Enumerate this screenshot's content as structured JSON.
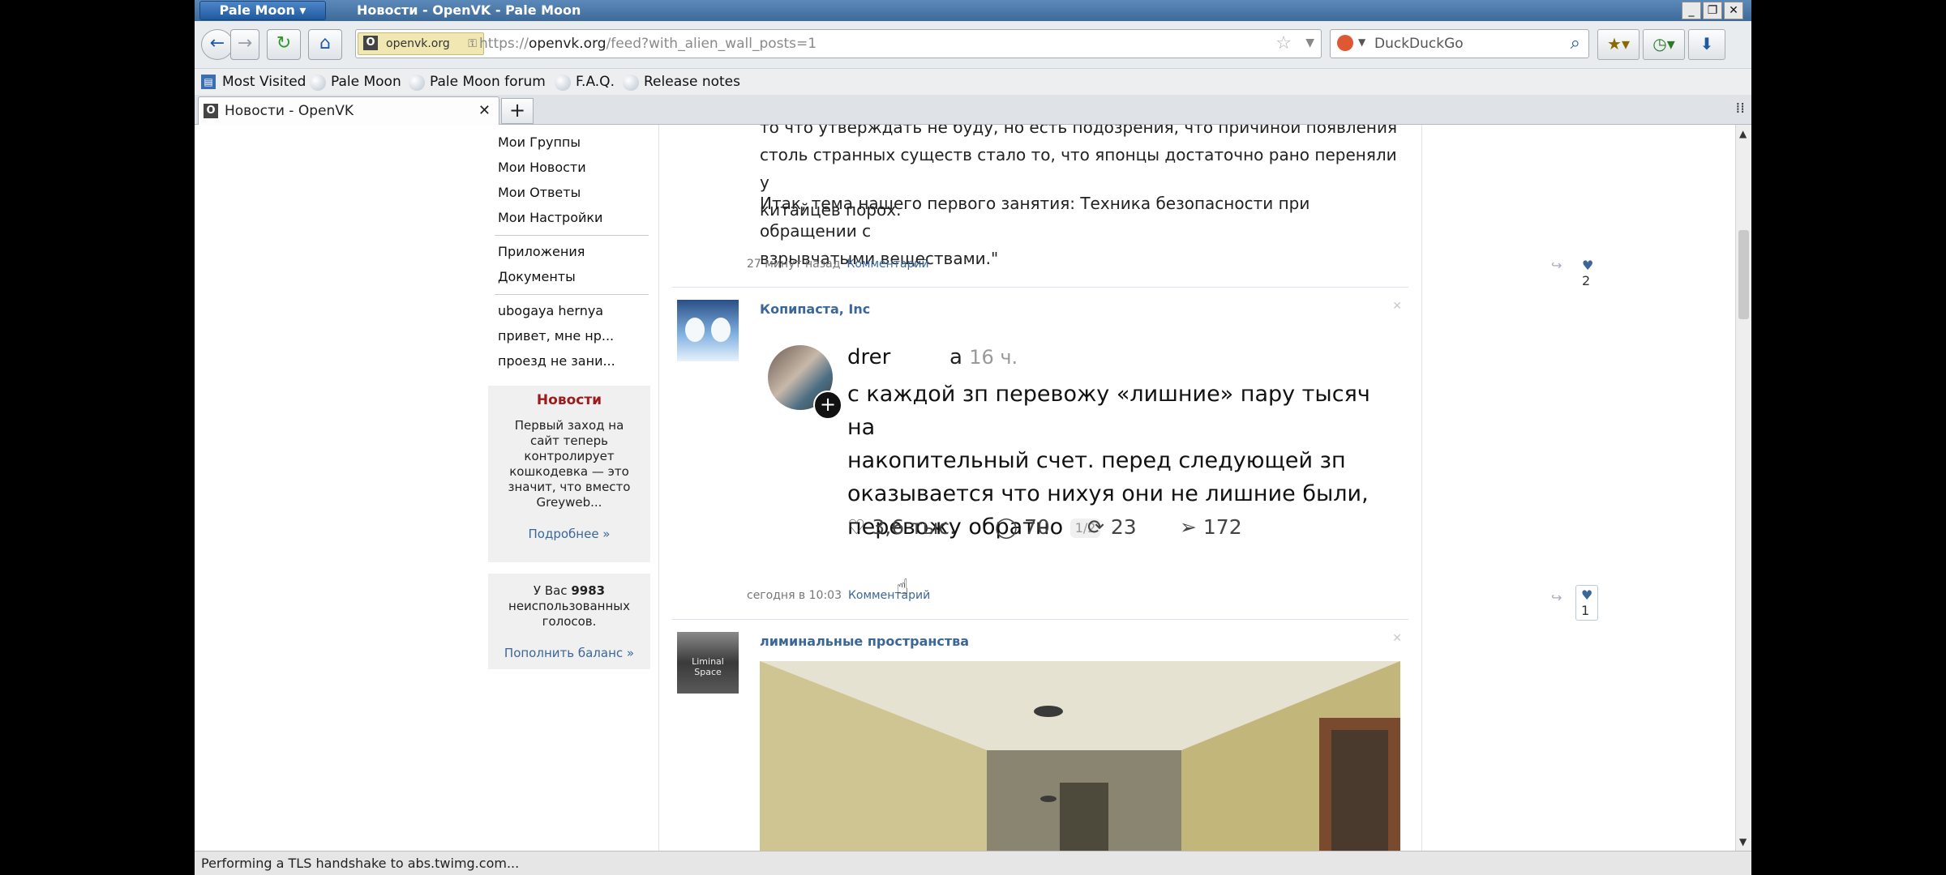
{
  "window": {
    "app_menu": "Pale Moon",
    "title": "Новости - OpenVK - Pale Moon",
    "min": "_",
    "restore": "❐",
    "close": "✕"
  },
  "nav": {
    "back": "←",
    "forward": "→",
    "reload": "↻",
    "home": "⌂",
    "identity": "openvk.org",
    "identity_icon": "O",
    "url_scheme": "https://",
    "url_host": "openvk.org",
    "url_path": "/feed?with_alien_wall_posts=1",
    "bookmark_star": "☆",
    "dropdown": "▼",
    "search_placeholder": "DuckDuckGo",
    "search_icon": "⌕",
    "bookmarks_menu_icon": "★▾",
    "history_icon": "◷▾",
    "downloads_icon": "⬇"
  },
  "bookmarks": [
    "Most Visited",
    "Pale Moon",
    "Pale Moon forum",
    "F.A.Q.",
    "Release notes"
  ],
  "tabs": {
    "active_label": "Новости - OpenVK",
    "active_icon": "O",
    "close": "✕",
    "new_tab": "+",
    "list_all": "⁞⁞"
  },
  "sidebar": {
    "items_group1": [
      "Мои Группы",
      "Мои Новости",
      "Мои Ответы",
      "Мои Настройки"
    ],
    "items_group2": [
      "Приложения",
      "Документы"
    ],
    "items_group3": [
      "ubogaya hernya",
      "привет, мне нр...",
      "проезд не зани..."
    ],
    "news_box": {
      "title": "Новости",
      "lines": [
        "Первый заход на",
        "сайт теперь",
        "контролирует",
        "кошкодевка — это",
        "значит, что вместо",
        "Greyweb..."
      ],
      "more": "Подробнее »"
    },
    "votes_box": {
      "prefix": "У Вас",
      "count": "9983",
      "line2": "неиспользованных",
      "line3": "голосов.",
      "link": "Пополнить баланс »"
    }
  },
  "posts": [
    {
      "text_lines": [
        "то что утверждать не буду, но есть подозрения, что причиной появления",
        "столь странных существ стало то, что японцы достаточно рано переняли у",
        "китайцев порох."
      ],
      "paragraph2_lines": [
        "Итак, тема нашего первого занятия: Техника безопасности при обращении с",
        "взрывчатыми веществами.\""
      ],
      "time": "27 минут назад",
      "comment_link": "Комментарий",
      "share_icon": "↪",
      "like_icon": "♥",
      "likes": "2"
    },
    {
      "author": "Копипаста, Inc",
      "delete_icon": "✕",
      "tweet": {
        "user": "drer",
        "time_prefix": "а",
        "time": "16 ч.",
        "plus": "+",
        "body_lines": [
          "с каждой зп перевожу «лишние» пару тысяч на",
          "накопительный счет. перед следующей зп",
          "оказывается что нихуя они не лишние были,",
          "перевожу обратно"
        ],
        "page_badge": "1/2",
        "stats": {
          "like_icon": "♡",
          "likes": "3,6 тыс.",
          "reply_icon": "◯",
          "replies": "70",
          "repost_icon": "⟳",
          "reposts": "23",
          "share_icon": "➢",
          "shares": "172"
        }
      },
      "time": "сегодня в 10:03",
      "comment_link": "Комментарий",
      "share_icon": "↪",
      "like_icon": "♥",
      "likes": "1"
    },
    {
      "author": "лиминальные пространства",
      "avatar_text": "Liminal Space",
      "delete_icon": "✕"
    }
  ],
  "status": "Performing a TLS handshake to abs.twimg.com...",
  "colors": {
    "link": "#3b6798",
    "news_title": "#9e1b1b",
    "titlebar": "#4a77a8"
  }
}
